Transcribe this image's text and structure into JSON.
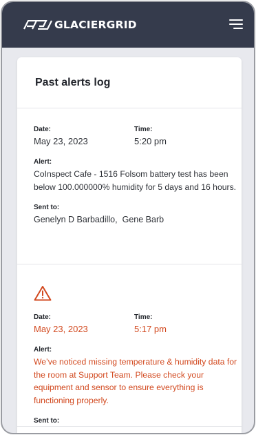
{
  "brand": {
    "name": "GLACIERGRID"
  },
  "card": {
    "title": "Past alerts log"
  },
  "alerts": [
    {
      "date_label": "Date:",
      "date": "May 23, 2023",
      "time_label": "Time:",
      "time": "5:20 pm",
      "alert_label": "Alert:",
      "alert_text": "CoInspect Cafe - 1516 Folsom battery test has been below 100.000000% humidity for 5 days and 16 hours.",
      "sent_label": "Sent to:",
      "recipients": [
        "Genelyn D Barbadillo,",
        "Gene Barb"
      ],
      "warning": false
    },
    {
      "date_label": "Date:",
      "date": "May 23, 2023",
      "time_label": "Time:",
      "time": "5:17 pm",
      "alert_label": "Alert:",
      "alert_text": "We’ve noticed missing temperature & humidity data for the room at Support Team. Please check your equipment and sensor to ensure everything is functioning properly.",
      "sent_label": "Sent to:",
      "warning": true
    }
  ],
  "colors": {
    "header_bg": "#353b4c",
    "warning": "#d2491f",
    "page_bg": "#e8e9ee"
  },
  "icons": {
    "menu": "hamburger-menu-icon",
    "warning": "warning-triangle-icon",
    "logo": "glaciergrid-logo-icon"
  }
}
